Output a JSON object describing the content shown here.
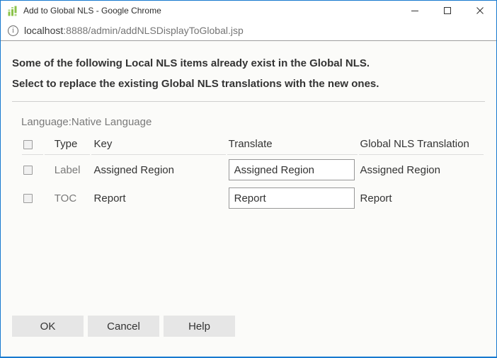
{
  "window": {
    "title": "Add to Global NLS - Google Chrome",
    "controls": {
      "minimize_icon": "minimize-icon",
      "maximize_icon": "maximize-icon",
      "close_icon": "close-icon"
    },
    "favicon": "green-bar-chart-icon"
  },
  "address_bar": {
    "info_icon": "page-info-icon",
    "info_glyph": "i",
    "host": "localhost",
    "path": ":8888/admin/addNLSDisplayToGlobal.jsp"
  },
  "message": {
    "line1": "Some of the following Local NLS items already exist in the Global NLS.",
    "line2": "Select to replace the existing Global NLS translations with the new ones."
  },
  "language_label": "Language:Native Language",
  "table": {
    "headers": {
      "type": "Type",
      "key": "Key",
      "translate": "Translate",
      "global": "Global NLS Translation"
    },
    "rows": [
      {
        "checked": false,
        "type": "Label",
        "key": "Assigned Region",
        "translate_value": "Assigned Region",
        "global": "Assigned Region"
      },
      {
        "checked": false,
        "type": "TOC",
        "key": "Report",
        "translate_value": "Report",
        "global": "Report"
      }
    ]
  },
  "buttons": {
    "ok": "OK",
    "cancel": "Cancel",
    "help": "Help"
  },
  "colors": {
    "window_border": "#1779cf",
    "favicon_green": "#8bc34a",
    "favicon_green_light": "#aed581",
    "text_dark": "#333333",
    "text_gray": "#797979",
    "button_bg": "#e6e6e6",
    "input_border": "#979797"
  }
}
